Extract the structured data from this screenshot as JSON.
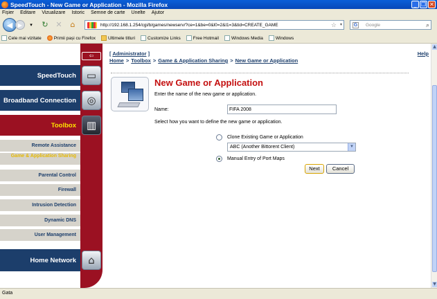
{
  "window": {
    "title": "SpeedTouch - New Game or Application - Mozilla Firefox"
  },
  "menu": [
    "Fișier",
    "Editare",
    "Vizualizare",
    "Istoric",
    "Semne de carte",
    "Unelte",
    "Ajutor"
  ],
  "nav": {
    "url": "http://192.168.1.254/cgi/b/games/newserv/?ce=1&be=0&l0=2&l1=3&tid=CREATE_GAME",
    "search_placeholder": "Google"
  },
  "bookmarks": [
    {
      "label": "Cele mai vizitate",
      "icon": "page-icon"
    },
    {
      "label": "Primii pași cu Firefox",
      "icon": "firefox-icon"
    },
    {
      "label": "Ultimele titluri",
      "icon": "rss-folder-icon"
    },
    {
      "label": "Customize Links",
      "icon": "page-icon"
    },
    {
      "label": "Free Hotmail",
      "icon": "page-icon"
    },
    {
      "label": "Windows Media",
      "icon": "page-icon"
    },
    {
      "label": "Windows",
      "icon": "page-icon"
    }
  ],
  "status": "Gata",
  "sidebar": {
    "speedtouch": "SpeedTouch",
    "broadband": "Broadband Connection",
    "toolbox": "Toolbox",
    "sub": [
      {
        "label": "Remote Assistance",
        "active": false
      },
      {
        "label": "Game & Application Sharing",
        "active": true
      },
      {
        "label": "Parental Control",
        "active": false
      },
      {
        "label": "Firewall",
        "active": false
      },
      {
        "label": "Intrusion Detection",
        "active": false
      },
      {
        "label": "Dynamic DNS",
        "active": false
      },
      {
        "label": "User Management",
        "active": false
      }
    ],
    "home_network": "Home Network"
  },
  "header": {
    "admin_open": "[ ",
    "admin": "Administrator",
    "admin_close": " ]",
    "help": "Help",
    "crumbs": [
      "Home",
      "Toolbox",
      "Game & Application Sharing",
      "New Game or Application"
    ],
    "crumb_sep": ">"
  },
  "form": {
    "title": "New Game or Application",
    "intro": "Enter the name of the new game or application.",
    "name_label": "Name:",
    "name_value": "FIFA 2008",
    "select_text": "Select how you want to define the new game or application.",
    "option_clone": "Clone Existing Game or Application",
    "clone_selected": "ABC (Another Bittorent Client)",
    "option_manual": "Manual Entry of Port Maps",
    "selected_option": "manual",
    "next_label": "Next",
    "cancel_label": "Cancel"
  }
}
